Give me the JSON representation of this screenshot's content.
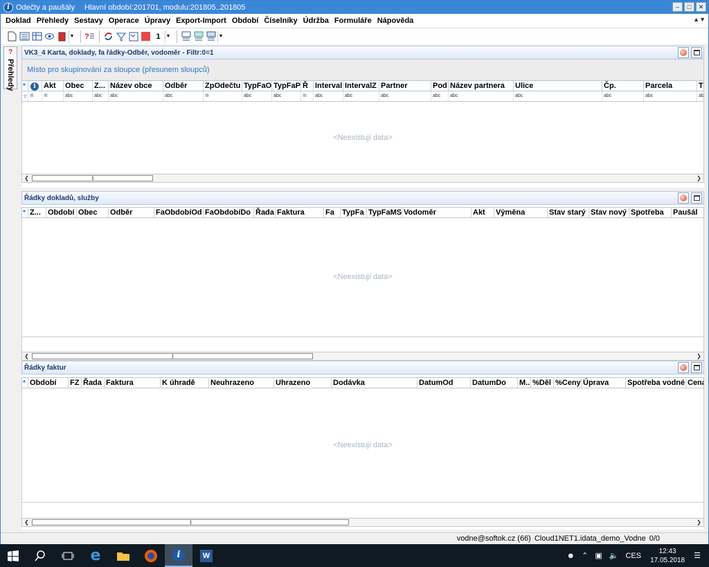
{
  "window": {
    "app_title": "Odečty a paušály",
    "period_title": "Hlavní období:201701, modulu:201805..201805"
  },
  "menu": [
    "Doklad",
    "Přehledy",
    "Sestavy",
    "Operace",
    "Úpravy",
    "Export-Import",
    "Období",
    "Číselníky",
    "Údržba",
    "Formuláře",
    "Nápověda"
  ],
  "toolbar": {
    "counter": "1"
  },
  "sidebar": {
    "label": "Přehledy"
  },
  "panel1": {
    "title": "VK3_4  Karta, doklady, fa řádky-Odběr, vodoměr  -  Filtr:0=1",
    "group_hint": "Místo pro skupinování za sloupce (přesunem sloupců)",
    "columns": [
      "Akt",
      "Obec",
      "Z...",
      "Název obce",
      "Odběr",
      "ZpOdečtu",
      "TypFaO",
      "TypFaP",
      "Ř",
      "Interval",
      "IntervalZ",
      "Partner",
      "Pod",
      "Název partnera",
      "Ulice",
      "Čp.",
      "Parcela",
      "T"
    ],
    "filters": [
      "=",
      "=",
      "abc",
      "abc",
      "abc",
      "abc",
      "=",
      "abc",
      "abc",
      "=",
      "abc",
      "abc",
      "abc",
      "abc",
      "abc",
      "abc",
      "abc",
      "abc",
      "abc"
    ],
    "empty_text": "<Neexistují data>"
  },
  "panel2": {
    "title": "Řádky dokladů, služby",
    "columns": [
      "Z...",
      "Období",
      "Obec",
      "Odběr",
      "FaObdobíOd",
      "FaObdobíDo",
      "Řada",
      "Faktura",
      "Fa",
      "TypFa",
      "TypFaMS",
      "Vodoměr",
      "Akt",
      "Výměna",
      "Stav starý",
      "Stav nový",
      "Spotřeba",
      "Paušál"
    ],
    "empty_text": "<Neexistují data>"
  },
  "panel3": {
    "title": "Řádky faktur",
    "columns": [
      "Období",
      "FZ",
      "Řada",
      "Faktura",
      "K úhradě",
      "Neuhrazeno",
      "Uhrazeno",
      "Dodávka",
      "DatumOd",
      "DatumDo",
      "M..",
      "%Děl",
      "%Ceny",
      "Úprava",
      "Spotřeba vodné",
      "Cena"
    ],
    "empty_text": "<Neexistují data>"
  },
  "statusbar": {
    "user": "vodne@softok.cz (66)",
    "database": "Cloud1NET1.idata_demo_Vodne",
    "count": "0/0"
  },
  "taskbar": {
    "language": "CES",
    "time": "12:43",
    "date": "17.05.2018"
  }
}
